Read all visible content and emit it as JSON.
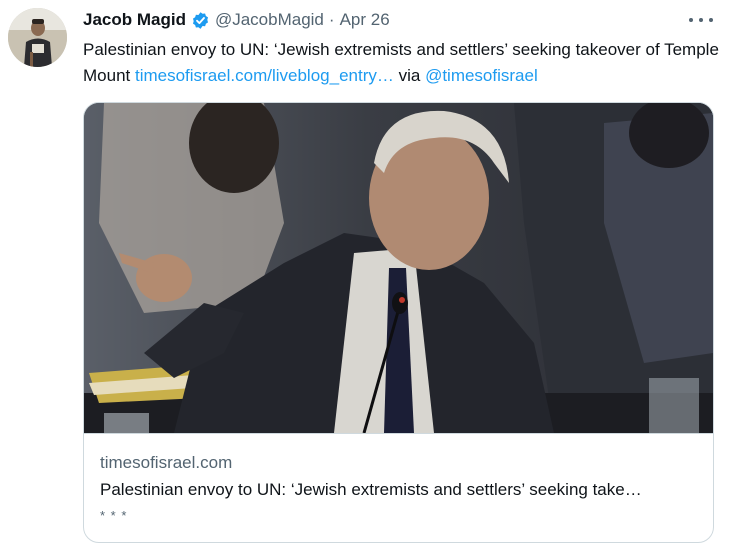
{
  "author": {
    "name": "Jacob Magid",
    "handle": "@JacobMagid",
    "separator": "·",
    "time": "Apr 26",
    "verified": true,
    "avatar_icon": "profile-photo"
  },
  "tweet": {
    "text": "Palestinian envoy to UN: ‘Jewish extremists and settlers’ seeking takeover of Temple Mount ",
    "link_text": "timesofisrael.com/liveblog_entry…",
    "via_text": " via ",
    "mention": "@timesofisrael"
  },
  "card": {
    "domain": "timesofisrael.com",
    "title": "Palestinian envoy to UN: ‘Jewish extremists and settlers’ seeking take…",
    "description": "* * *",
    "image_icon": "news-photo"
  },
  "colors": {
    "accent": "#1d9bf0",
    "secondary_text": "#536471",
    "border": "#cfd9de"
  }
}
